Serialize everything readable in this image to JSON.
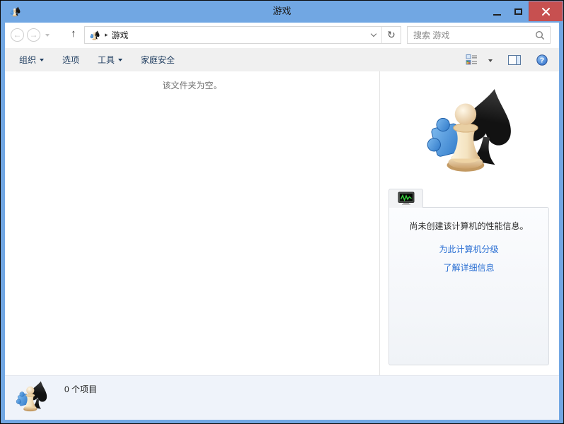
{
  "window": {
    "title": "游戏"
  },
  "navbar": {
    "breadcrumb_root": "游戏",
    "search_placeholder": "搜索 游戏"
  },
  "toolbar": {
    "items": [
      {
        "label": "组织",
        "dropdown": true
      },
      {
        "label": "选项",
        "dropdown": false
      },
      {
        "label": "工具",
        "dropdown": true
      },
      {
        "label": "家庭安全",
        "dropdown": false
      }
    ]
  },
  "main": {
    "empty_message": "该文件夹为空。"
  },
  "details_pane": {
    "message": "尚未创建该计算机的性能信息。",
    "links": [
      {
        "label": "为此计算机分级"
      },
      {
        "label": "了解详细信息"
      }
    ]
  },
  "statusbar": {
    "item_count": "0 个项目"
  },
  "colors": {
    "frame": "#71a7e3",
    "close_button": "#c75050",
    "link": "#2a6fd3",
    "toolbar_text": "#1e3c5f"
  }
}
